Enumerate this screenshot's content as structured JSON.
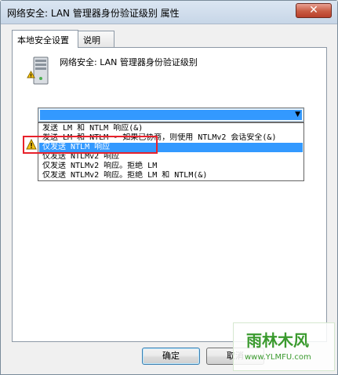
{
  "window": {
    "title": "网络安全: LAN 管理器身份验证级别 属性",
    "close_glyph": "✕"
  },
  "tabs": [
    {
      "label": "本地安全设置",
      "active": true
    },
    {
      "label": "说明",
      "active": false
    }
  ],
  "policy": {
    "title": "网络安全: LAN 管理器身份验证级别",
    "icon": "server-policy-icon"
  },
  "combo": {
    "selected_value": "",
    "arrow_icon": "chevron-down-icon"
  },
  "dropdown": {
    "options": [
      "发送 LM 和 NTLM 响应(&)",
      "发送 LM 和 NTLM - 如果已协商，则使用 NTLMv2 会话安全(&)",
      "仅发送 NTLM 响应",
      "仅发送 NTLMv2 响应",
      "仅发送 NTLMv2 响应。拒绝 LM",
      "仅发送 NTLMv2 响应。拒绝 LM 和 NTLM(&)"
    ],
    "selected_index": 2
  },
  "buttons": {
    "ok": "确定",
    "cancel": "取消"
  },
  "watermark": {
    "name": "雨林木风",
    "url": "www.YLMFU.com"
  },
  "colors": {
    "highlight": "#3399ff",
    "annotation_box": "#e8212b",
    "watermark": "#3a9a2e"
  }
}
